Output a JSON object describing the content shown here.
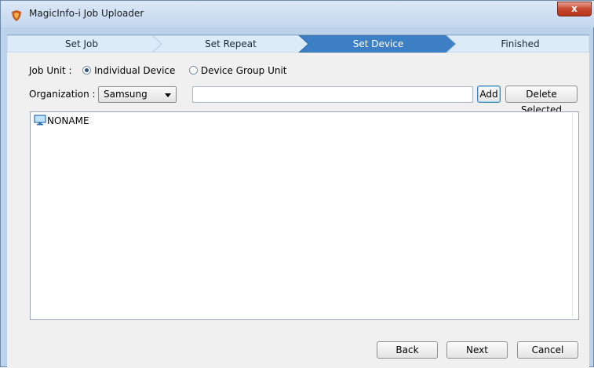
{
  "window": {
    "title": "MagicInfo-i Job Uploader",
    "close_glyph": "x"
  },
  "steps": [
    {
      "label": "Set Job",
      "active": false
    },
    {
      "label": "Set Repeat",
      "active": false
    },
    {
      "label": "Set Device",
      "active": true
    },
    {
      "label": "Finished",
      "active": false
    }
  ],
  "job_unit": {
    "label": "Job Unit :",
    "options": [
      {
        "label": "Individual Device",
        "checked": true
      },
      {
        "label": "Device Group Unit",
        "checked": false
      }
    ]
  },
  "organization": {
    "label": "Organization :",
    "selected": "Samsung",
    "search_value": ""
  },
  "buttons": {
    "add": "Add",
    "delete_selected": "Delete Selected",
    "back": "Back",
    "next": "Next",
    "cancel": "Cancel"
  },
  "device_list": {
    "items": [
      {
        "label": "NONAME",
        "icon": "monitor-icon"
      }
    ]
  },
  "colors": {
    "active_step": "#3d7fc4",
    "inactive_step": "#dcebf7",
    "window_frame": "#bcd2ea",
    "close_button": "#c7482f"
  }
}
